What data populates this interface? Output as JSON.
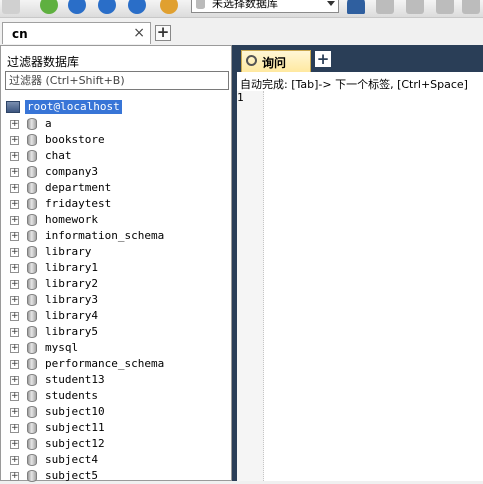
{
  "toolbar": {
    "database_select": {
      "value": "未选择数据库"
    }
  },
  "connection_tab": {
    "label": "cn",
    "close_glyph": "×",
    "add_glyph": "+"
  },
  "filter": {
    "title": "过滤器数据库",
    "placeholder": "过滤器 (Ctrl+Shift+B)"
  },
  "tree": {
    "root": "root@localhost",
    "expand_glyph": "+",
    "databases": [
      "a",
      "bookstore",
      "chat",
      "company3",
      "department",
      "fridaytest",
      "homework",
      "information_schema",
      "library",
      "library1",
      "library2",
      "library3",
      "library4",
      "library5",
      "mysql",
      "performance_schema",
      "student13",
      "students",
      "subject10",
      "subject11",
      "subject12",
      "subject4",
      "subject5"
    ]
  },
  "query_tab": {
    "label": "询问",
    "add_glyph": "+"
  },
  "editor": {
    "autocomplete_hint": "自动完成: [Tab]-> 下一个标签, [Ctrl+Space]",
    "line_number": "1"
  },
  "colors": {
    "splitter": "#2a3e57",
    "selection": "#3875d7",
    "query_tab_bg": "#ffe9a0"
  }
}
